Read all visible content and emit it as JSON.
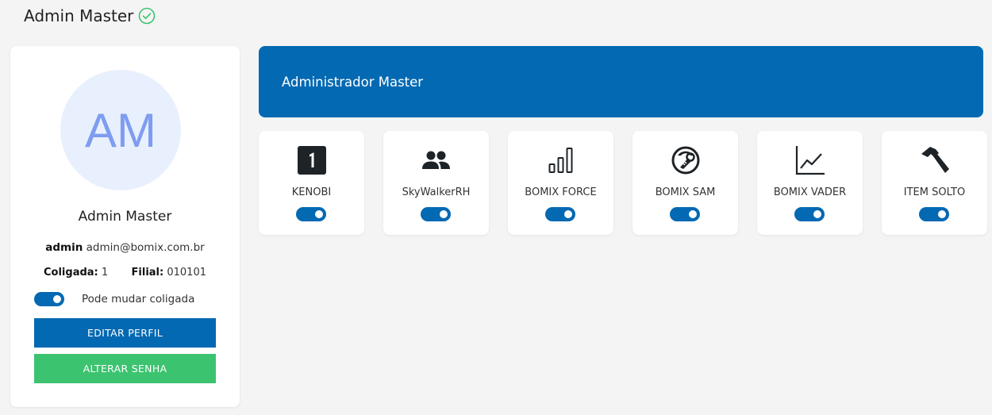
{
  "header": {
    "title": "Admin Master",
    "verified_icon": "check-circle-icon",
    "verified_color": "#3cc370"
  },
  "profile": {
    "initials": "AM",
    "name": "Admin Master",
    "username": "admin",
    "email": "admin@bomix.com.br",
    "coligada_label": "Coligada:",
    "coligada_value": "1",
    "filial_label": "Filial:",
    "filial_value": "010101",
    "change_coligada_label": "Pode mudar coligada",
    "change_coligada_enabled": true,
    "edit_button": "EDITAR PERFIL",
    "password_button": "ALTERAR SENHA"
  },
  "role": {
    "title": "Administrador Master"
  },
  "modules": [
    {
      "label": "KENOBI",
      "icon": "number-one-icon",
      "enabled": true
    },
    {
      "label": "SkyWalkerRH",
      "icon": "people-icon",
      "enabled": true
    },
    {
      "label": "BOMIX FORCE",
      "icon": "bar-chart-icon",
      "enabled": true
    },
    {
      "label": "BOMIX SAM",
      "icon": "wrench-circle-icon",
      "enabled": true
    },
    {
      "label": "BOMIX VADER",
      "icon": "line-chart-icon",
      "enabled": true
    },
    {
      "label": "ITEM SOLTO",
      "icon": "hammer-icon",
      "enabled": true
    }
  ],
  "colors": {
    "primary": "#0369b3",
    "success": "#3cc370",
    "avatar_bg": "#e8f0fd",
    "avatar_text": "#7e9df0"
  }
}
